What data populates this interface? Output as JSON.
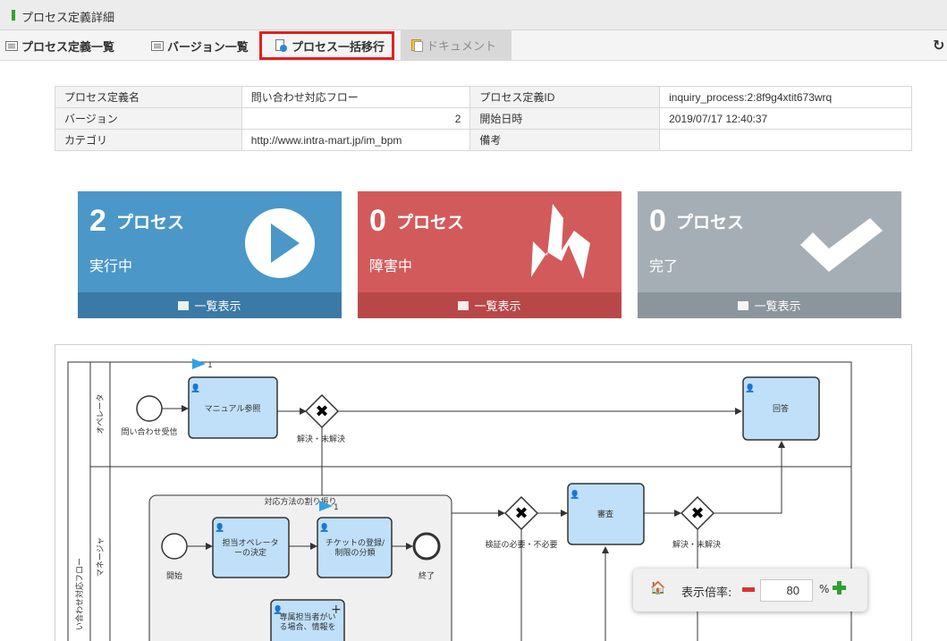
{
  "window": {
    "title": "プロセス定義詳細"
  },
  "tabs": {
    "list": "プロセス定義一覧",
    "versions": "バージョン一覧",
    "migrate": "プロセス一括移行",
    "document": "ドキュメント"
  },
  "info": {
    "rows": [
      [
        "プロセス定義名",
        "問い合わせ対応フロー",
        "プロセス定義ID",
        "inquiry_process:2:8f9g4xtit673wrq"
      ],
      [
        "バージョン",
        "2",
        "開始日時",
        "2019/07/17 12:40:37"
      ],
      [
        "カテゴリ",
        "http://www.intra-mart.jp/im_bpm",
        "備考",
        ""
      ]
    ]
  },
  "cards": {
    "running": {
      "count": "2",
      "unit": "プロセス",
      "label": "実行中",
      "link": "一覧表示",
      "color": "#4b97c7"
    },
    "error": {
      "count": "0",
      "unit": "プロセス",
      "label": "障害中",
      "link": "一覧表示",
      "color": "#d35a5a"
    },
    "done": {
      "count": "0",
      "unit": "プロセス",
      "label": "完了",
      "link": "一覧表示",
      "color": "#a5aeb4"
    }
  },
  "diagram": {
    "lanes": [
      "オペレータ",
      "マネージャ"
    ],
    "pool": "い合わせ対応フロー",
    "start_event": "問い合わせ受信",
    "task_manual": "マニュアル参照",
    "gateway_resolved": "解決・未解決",
    "task_answer": "回答",
    "subprocess": "対応方法の割り振り",
    "sub_start": "開始",
    "task_assign_line1": "担当オペレータ",
    "task_assign_line2": "ーの決定",
    "task_ticket_line1": "チケットの登録/",
    "task_ticket_line2": "制限の分類",
    "sub_end": "終了",
    "task_special_line1": "専属担当者がい",
    "task_special_line2": "る場合、情報を",
    "gateway_verify": "検証の必要・不必要",
    "task_review": "審査",
    "gateway_resolved2": "解決・未解決",
    "token_count_1": "1",
    "token_count_2": "1"
  },
  "zoom": {
    "label": "表示倍率:",
    "value": "80",
    "unit": "%"
  }
}
